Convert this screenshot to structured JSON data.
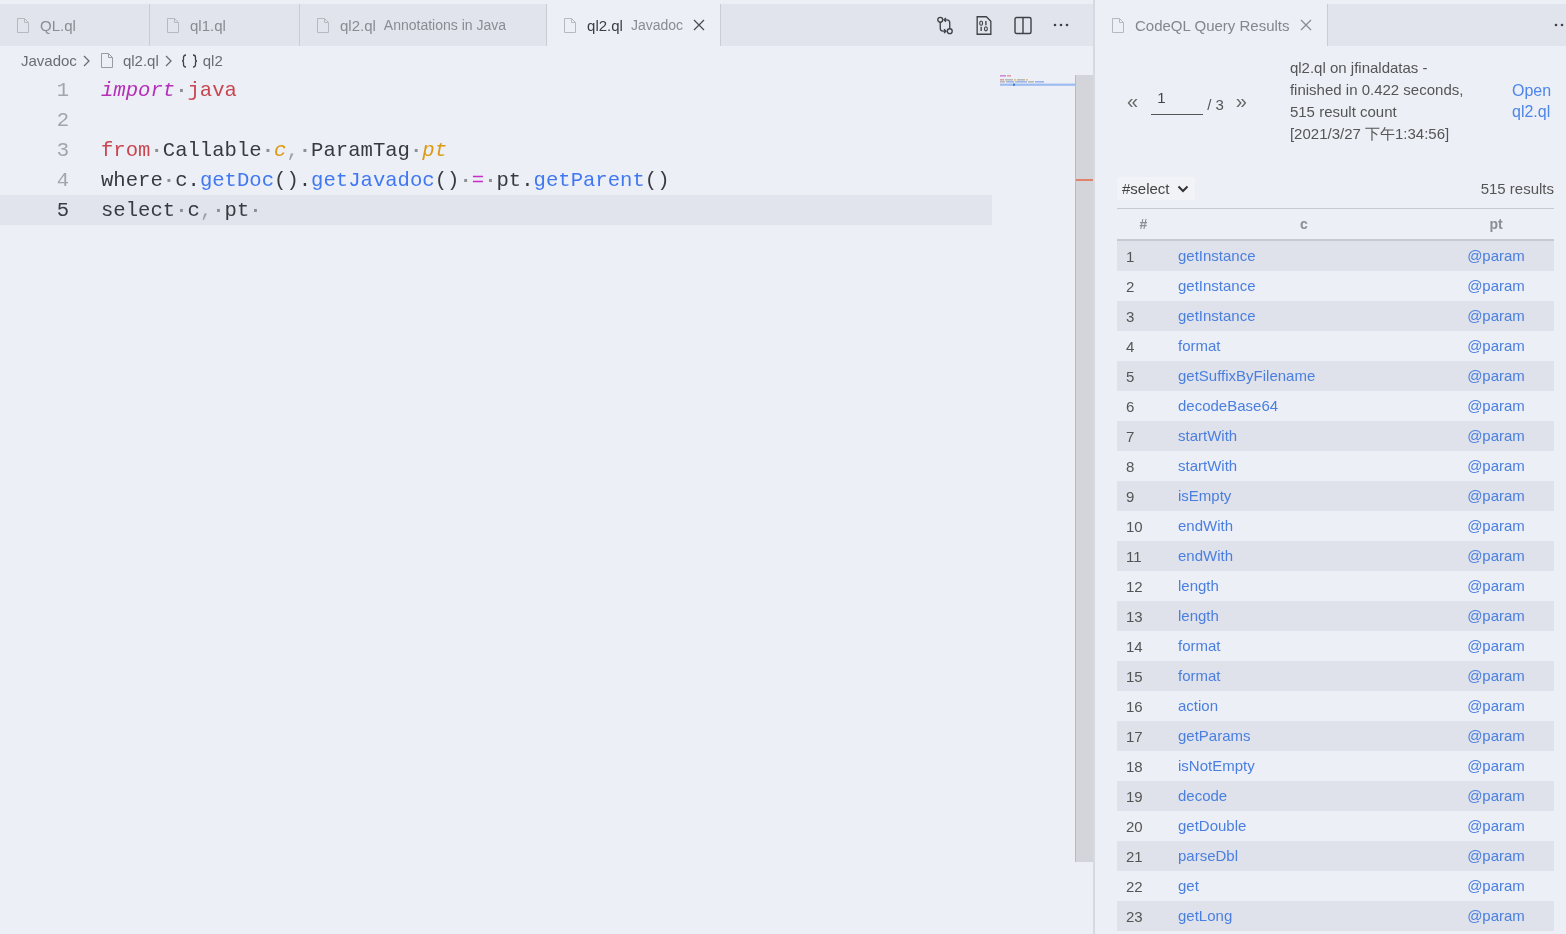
{
  "editor": {
    "focused": true,
    "tabs": [
      {
        "label": "QL.ql",
        "selected": false
      },
      {
        "label": "ql1.ql",
        "selected": false
      },
      {
        "label": "ql2.ql",
        "description": "Annotations in Java",
        "selected": false
      },
      {
        "label": "ql2.ql",
        "description": "Javadoc",
        "selected": true
      }
    ],
    "breadcrumbs": [
      {
        "label": "Javadoc",
        "kind": "folder"
      },
      {
        "label": "ql2.ql",
        "kind": "file"
      },
      {
        "label": "ql2",
        "kind": "module"
      }
    ],
    "lines": [
      {
        "number": "1",
        "current": false,
        "tokens": [
          {
            "text": "import",
            "kind": "import"
          },
          {
            "text": "·",
            "kind": "space"
          },
          {
            "text": "java",
            "kind": "keyword"
          }
        ]
      },
      {
        "number": "2",
        "current": false
      },
      {
        "number": "3",
        "current": false,
        "tokens": [
          {
            "text": "from",
            "kind": "keyword"
          },
          {
            "text": "·",
            "kind": "space"
          },
          {
            "text": "Callable",
            "kind": "plain"
          },
          {
            "text": "·",
            "kind": "space"
          },
          {
            "text": "c",
            "kind": "variable"
          },
          {
            "text": ",",
            "kind": "punct"
          },
          {
            "text": "·",
            "kind": "space"
          },
          {
            "text": "ParamTag",
            "kind": "plain"
          },
          {
            "text": "·",
            "kind": "space"
          },
          {
            "text": "pt",
            "kind": "variable"
          }
        ]
      },
      {
        "number": "4",
        "current": false,
        "tokens": [
          {
            "text": "where",
            "kind": "plain"
          },
          {
            "text": "·",
            "kind": "space"
          },
          {
            "text": "c.",
            "kind": "plain"
          },
          {
            "text": "getDoc",
            "kind": "function"
          },
          {
            "text": "().",
            "kind": "plain"
          },
          {
            "text": "getJavadoc",
            "kind": "function"
          },
          {
            "text": "()",
            "kind": "plain"
          },
          {
            "text": "·",
            "kind": "space"
          },
          {
            "text": "=",
            "kind": "operator"
          },
          {
            "text": "·",
            "kind": "space"
          },
          {
            "text": "pt.",
            "kind": "plain"
          },
          {
            "text": "getParent",
            "kind": "function"
          },
          {
            "text": "()",
            "kind": "plain"
          }
        ]
      },
      {
        "number": "5",
        "current": true,
        "tokens": [
          {
            "text": "select",
            "kind": "plain"
          },
          {
            "text": "·",
            "kind": "space"
          },
          {
            "text": "c",
            "kind": "plain"
          },
          {
            "text": ",",
            "kind": "punct"
          },
          {
            "text": "·",
            "kind": "space"
          },
          {
            "text": "pt",
            "kind": "plain"
          },
          {
            "text": "·",
            "kind": "space"
          }
        ]
      }
    ]
  },
  "results": {
    "focused": false,
    "tabs": [
      {
        "label": "CodeQL Query Results",
        "selected": true
      }
    ],
    "pagination": {
      "prev": "«",
      "page": "1",
      "total": "/ 3",
      "next": "»"
    },
    "summary_lines": [
      "ql2.ql on jfinaldatas -",
      "finished in 0.422 seconds,",
      "515 result count",
      "[2021/3/27 下午1:34:56]"
    ],
    "open_link": "Open ql2.ql",
    "result_set": "#select",
    "result_count": "515 results",
    "table": {
      "columns": [
        "#",
        "c",
        "pt"
      ],
      "rows": [
        [
          "1",
          "getInstance",
          "@param"
        ],
        [
          "2",
          "getInstance",
          "@param"
        ],
        [
          "3",
          "getInstance",
          "@param"
        ],
        [
          "4",
          "format",
          "@param"
        ],
        [
          "5",
          "getSuffixByFilename",
          "@param"
        ],
        [
          "6",
          "decodeBase64",
          "@param"
        ],
        [
          "7",
          "startWith",
          "@param"
        ],
        [
          "8",
          "startWith",
          "@param"
        ],
        [
          "9",
          "isEmpty",
          "@param"
        ],
        [
          "10",
          "endWith",
          "@param"
        ],
        [
          "11",
          "endWith",
          "@param"
        ],
        [
          "12",
          "length",
          "@param"
        ],
        [
          "13",
          "length",
          "@param"
        ],
        [
          "14",
          "format",
          "@param"
        ],
        [
          "15",
          "format",
          "@param"
        ],
        [
          "16",
          "action",
          "@param"
        ],
        [
          "17",
          "getParams",
          "@param"
        ],
        [
          "18",
          "isNotEmpty",
          "@param"
        ],
        [
          "19",
          "decode",
          "@param"
        ],
        [
          "20",
          "getDouble",
          "@param"
        ],
        [
          "21",
          "parseDbl",
          "@param"
        ],
        [
          "22",
          "get",
          "@param"
        ],
        [
          "23",
          "getLong",
          "@param"
        ]
      ]
    }
  }
}
